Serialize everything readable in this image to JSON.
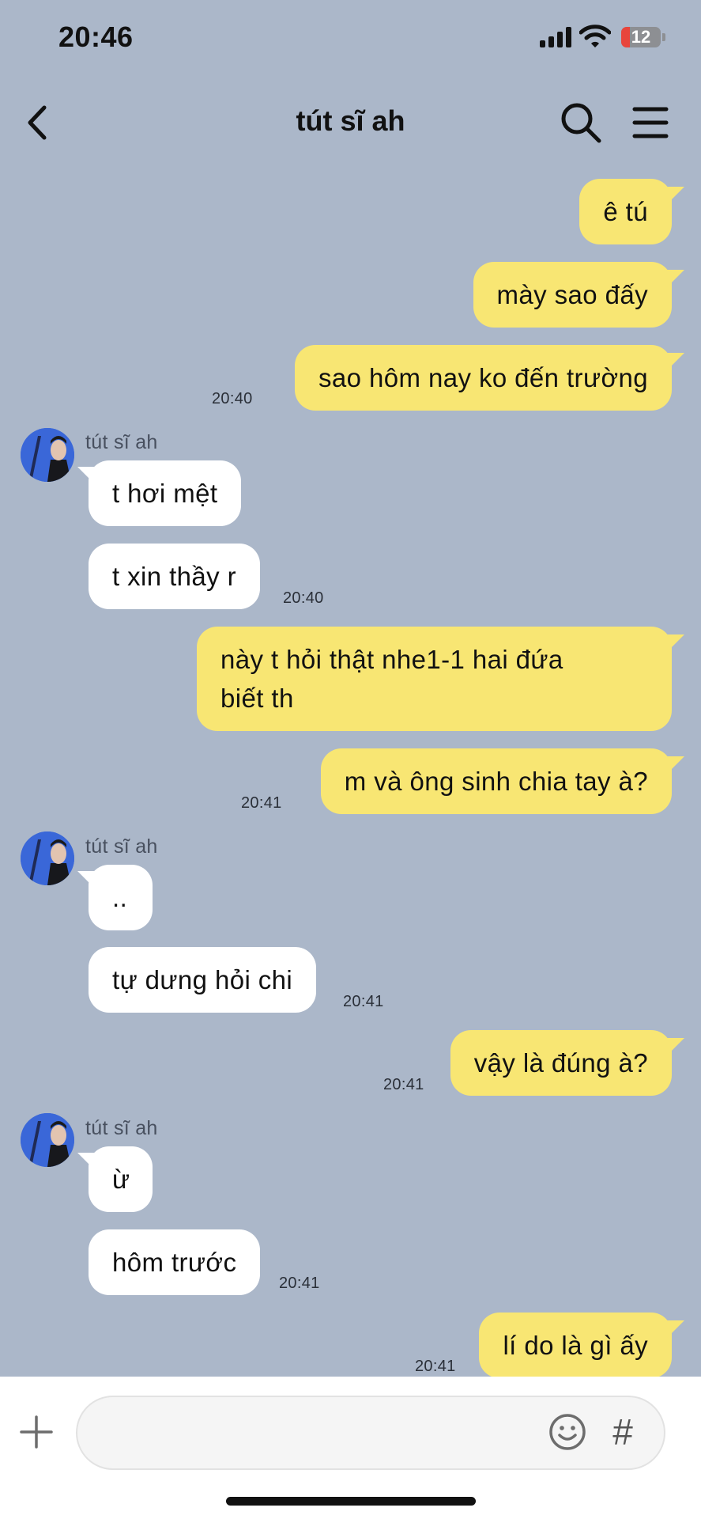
{
  "status": {
    "time": "20:46",
    "battery": "12"
  },
  "nav": {
    "title": "tút sĩ ah",
    "back_icon": "chevron-left-icon",
    "search_icon": "search-icon",
    "menu_icon": "hamburger-menu-icon"
  },
  "colors": {
    "background": "#abb7c9",
    "outgoing": "#f8e673",
    "incoming": "#ffffff"
  },
  "messages": [
    {
      "dir": "out",
      "text": "ê tú"
    },
    {
      "dir": "out",
      "text": "mày sao đấy"
    },
    {
      "dir": "out",
      "text": "sao hôm nay ko đến trường",
      "time": "20:40"
    },
    {
      "dir": "in",
      "sender": "tút sĩ ah",
      "text": "t hơi mệt"
    },
    {
      "dir": "in",
      "text": "t xin thầy r",
      "time": "20:40"
    },
    {
      "dir": "out",
      "text_line1": "này t hỏi thật nhe1-1 hai đứa",
      "text_line2": "biết th"
    },
    {
      "dir": "out",
      "text": "m và ông sinh chia tay à?",
      "time": "20:41"
    },
    {
      "dir": "in",
      "sender": "tút sĩ ah",
      "text": ".."
    },
    {
      "dir": "in",
      "text": "tự dưng hỏi chi",
      "time": "20:41"
    },
    {
      "dir": "out",
      "text": "vậy là đúng à?",
      "time": "20:41"
    },
    {
      "dir": "in",
      "sender": "tút sĩ ah",
      "text": "ừ"
    },
    {
      "dir": "in",
      "text": "hôm trước",
      "time": "20:41"
    },
    {
      "dir": "out",
      "text": "lí do là gì ấy",
      "time": "20:41"
    }
  ],
  "composer": {
    "plus_icon": "plus-icon",
    "emoji_icon": "emoji-icon",
    "hash_label": "#"
  }
}
